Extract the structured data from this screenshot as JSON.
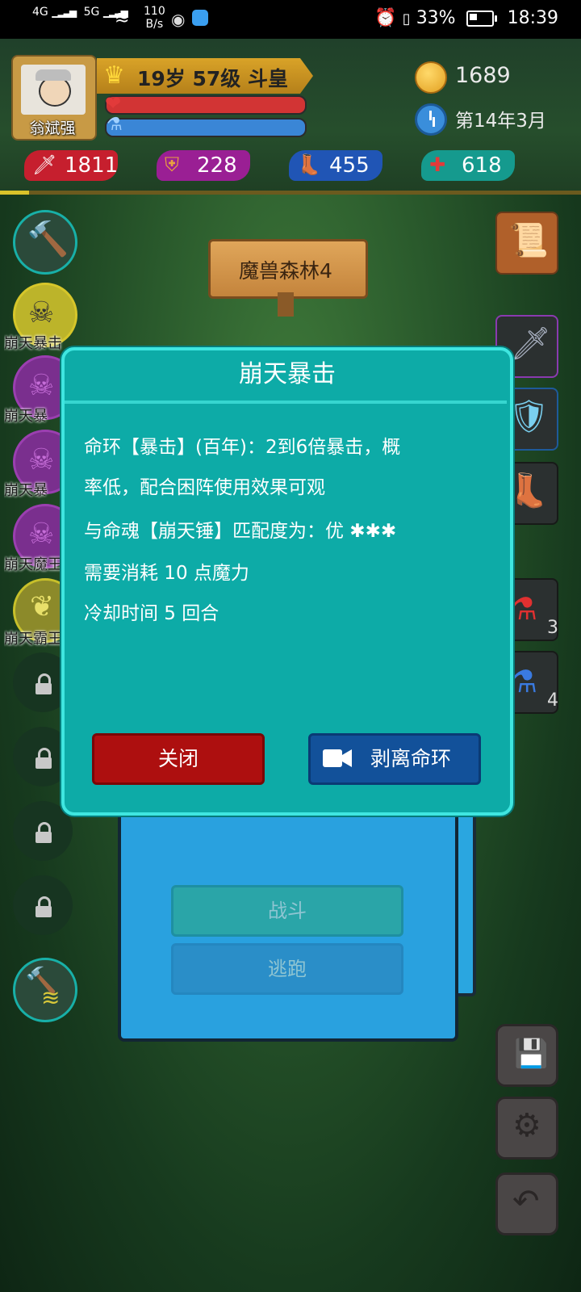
{
  "status_bar": {
    "net_left": "4G",
    "net_5g": "5G",
    "speed_value": "110",
    "speed_unit": "B/s",
    "battery": "33%",
    "time": "18:39"
  },
  "player": {
    "name": "翁斌强",
    "title": "19岁 57级 斗皇",
    "hp_level": 0.97,
    "mp_level": 0.97,
    "coins": "1689",
    "date": "第14年3月"
  },
  "stats": {
    "attack": "1811",
    "defense": "228",
    "speed": "455",
    "health": "618"
  },
  "location": "魔兽森林4",
  "skills": [
    {
      "label": "",
      "state": "equipped"
    },
    {
      "label": "崩天暴击",
      "state": "active"
    },
    {
      "label": "崩天暴",
      "state": "active"
    },
    {
      "label": "崩天暴",
      "state": "active"
    },
    {
      "label": "崩天魔王",
      "state": "active"
    },
    {
      "label": "崩天霸王",
      "state": "active"
    },
    {
      "label": "",
      "state": "locked"
    },
    {
      "label": "",
      "state": "locked"
    },
    {
      "label": "",
      "state": "locked"
    },
    {
      "label": "",
      "state": "locked"
    },
    {
      "label": "",
      "state": "equipped"
    }
  ],
  "items": {
    "red_potion_count": "3",
    "blue_potion_count": "4"
  },
  "battle_panel": {
    "fight": "战斗",
    "flee": "逃跑"
  },
  "dialog": {
    "title": "崩天暴击",
    "line1": "命环【暴击】(百年)：2到6倍暴击，概",
    "line2": "率低，配合困阵使用效果可观",
    "line3": "与命魂【崩天锤】匹配度为：优 ✱✱✱",
    "line4": "需要消耗 10 点魔力",
    "line5": "冷却时间 5 回合",
    "close": "关闭",
    "strip": "剥离命环"
  },
  "colors": {
    "dialog_bg": "#0daba7",
    "close_btn": "#ad0f0f",
    "strip_btn": "#12519a"
  },
  "icons": [
    "sword-icon",
    "shield-icon",
    "boot-icon",
    "heart-cross-icon",
    "crown-icon",
    "coin-icon",
    "clock-icon",
    "map-scroll-icon",
    "weapon-icon",
    "armor-icon",
    "boots-item-icon",
    "red-potion-icon",
    "blue-potion-icon",
    "save-icon",
    "gear-icon",
    "back-icon",
    "camera-icon",
    "lock-icon"
  ]
}
